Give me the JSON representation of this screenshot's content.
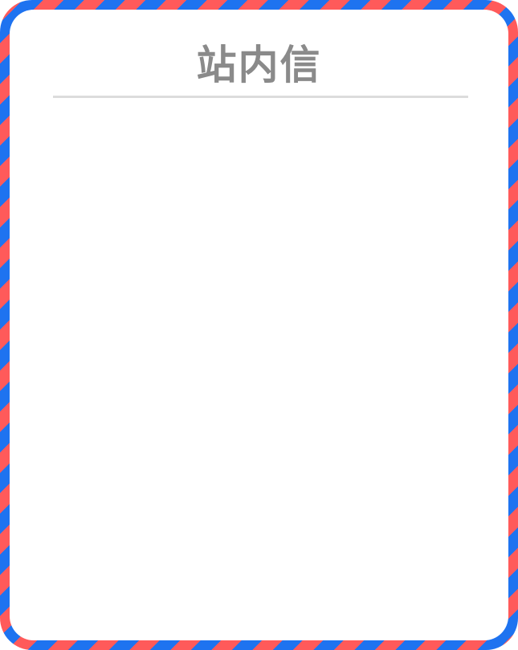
{
  "dialog": {
    "title": "站内信"
  },
  "colors": {
    "stripe_red": "#ff5a5a",
    "stripe_blue": "#1e73f0",
    "title_gray": "#8a8a8a",
    "divider_gray": "#dcdcdc"
  }
}
